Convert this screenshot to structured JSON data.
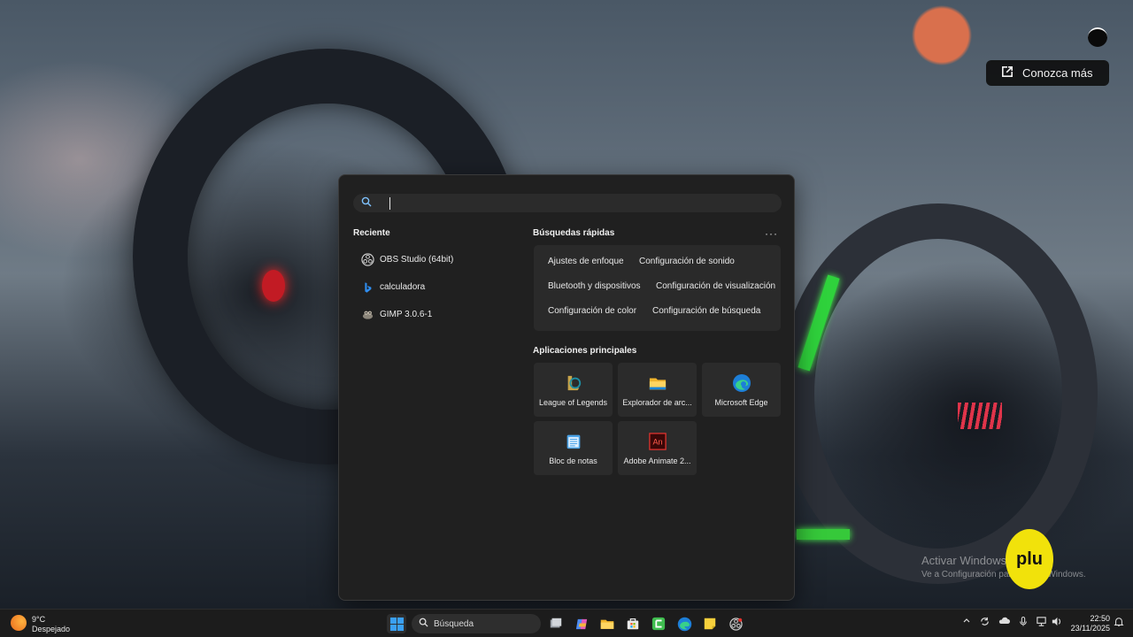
{
  "overlay": {
    "learn_more_label": "Conozca más"
  },
  "watermark": {
    "title": "Activar Windows",
    "subtitle": "Ve a Configuración para activar Windows.",
    "badge": "plu"
  },
  "search_panel": {
    "input_value": "",
    "recent": {
      "title": "Reciente",
      "items": [
        {
          "label": "OBS Studio (64bit)",
          "icon": "obs-icon"
        },
        {
          "label": "calculadora",
          "icon": "bing-icon"
        },
        {
          "label": "GIMP 3.0.6-1",
          "icon": "gimp-icon"
        }
      ]
    },
    "quick_searches": {
      "title": "Búsquedas rápidas",
      "more": "···",
      "chips": [
        "Ajustes de enfoque",
        "Configuración de sonido",
        "Bluetooth y dispositivos",
        "Configuración de visualización",
        "Configuración de color",
        "Configuración de búsqueda"
      ]
    },
    "top_apps": {
      "title": "Aplicaciones principales",
      "apps": [
        {
          "label": "League of Legends",
          "icon": "league-of-legends-icon"
        },
        {
          "label": "Explorador de arc...",
          "icon": "file-explorer-icon"
        },
        {
          "label": "Microsoft Edge",
          "icon": "edge-icon"
        },
        {
          "label": "Bloc de notas",
          "icon": "notepad-icon"
        },
        {
          "label": "Adobe Animate 2...",
          "icon": "adobe-animate-icon"
        }
      ]
    }
  },
  "taskbar": {
    "weather": {
      "temp": "9°C",
      "condition": "Despejado"
    },
    "search_label": "Búsqueda",
    "clock": {
      "time": "22:50",
      "date": "23/11/2025"
    },
    "pinned_icons": [
      "windows-start-icon",
      "task-view-icon",
      "copilot-icon",
      "file-explorer-icon",
      "store-icon",
      "camtasia-icon",
      "edge-icon",
      "sticky-notes-icon",
      "obs-icon"
    ],
    "tray_icons": [
      "chevron-up-icon",
      "sync-icon",
      "onedrive-icon",
      "microphone-icon",
      "network-icon",
      "volume-icon",
      "notification-icon"
    ]
  },
  "colors": {
    "panel_bg": "#202020",
    "tile_bg": "#2b2b2b",
    "accent": "#0078d4"
  }
}
